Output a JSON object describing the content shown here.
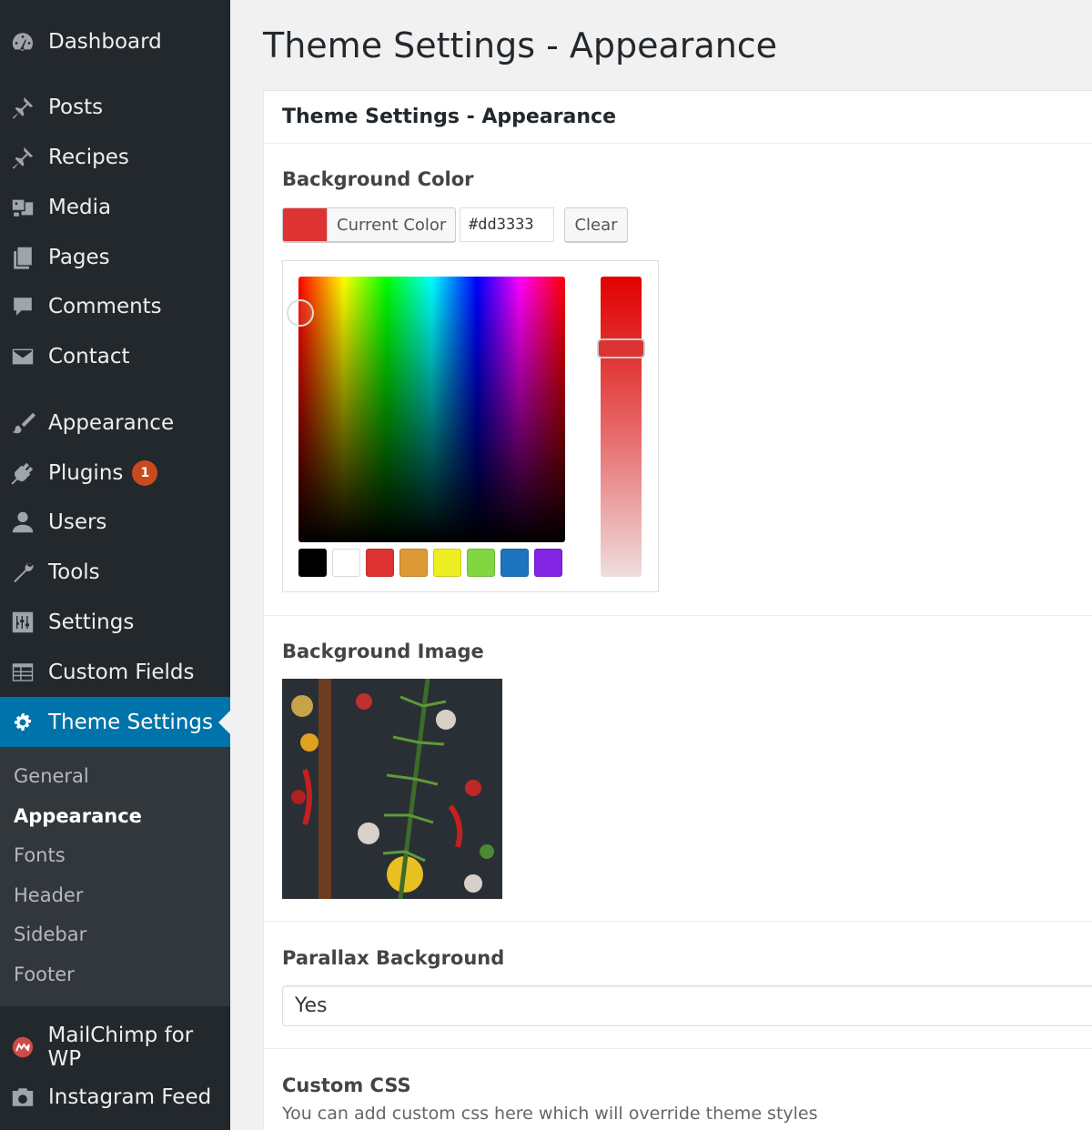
{
  "sidebar": {
    "items": [
      {
        "label": "Dashboard",
        "icon": "dashboard-icon"
      },
      {
        "label": "Posts",
        "icon": "pin-icon"
      },
      {
        "label": "Recipes",
        "icon": "pin-icon"
      },
      {
        "label": "Media",
        "icon": "media-icon"
      },
      {
        "label": "Pages",
        "icon": "pages-icon"
      },
      {
        "label": "Comments",
        "icon": "comment-icon"
      },
      {
        "label": "Contact",
        "icon": "envelope-icon"
      },
      {
        "label": "Appearance",
        "icon": "brush-icon"
      },
      {
        "label": "Plugins",
        "icon": "plug-icon",
        "badge": "1"
      },
      {
        "label": "Users",
        "icon": "user-icon"
      },
      {
        "label": "Tools",
        "icon": "wrench-icon"
      },
      {
        "label": "Settings",
        "icon": "sliders-icon"
      },
      {
        "label": "Custom Fields",
        "icon": "table-icon"
      },
      {
        "label": "Theme Settings",
        "icon": "gear-icon"
      },
      {
        "label": "MailChimp for WP",
        "icon": "mailchimp-icon"
      },
      {
        "label": "Instagram Feed",
        "icon": "camera-icon"
      }
    ],
    "submenu": [
      "General",
      "Appearance",
      "Fonts",
      "Header",
      "Sidebar",
      "Footer"
    ],
    "active_item": "Theme Settings",
    "active_sub": "Appearance"
  },
  "page": {
    "title": "Theme Settings - Appearance",
    "panel_title": "Theme Settings - Appearance"
  },
  "background_color": {
    "label": "Background Color",
    "button_label": "Current Color",
    "hex": "#dd3333",
    "clear_label": "Clear",
    "palette": [
      "#000000",
      "#ffffff",
      "#dd3333",
      "#dd9933",
      "#eeee22",
      "#81d742",
      "#1e73be",
      "#8224e3"
    ]
  },
  "background_image": {
    "label": "Background Image"
  },
  "parallax": {
    "label": "Parallax Background",
    "value": "Yes"
  },
  "custom_css": {
    "label": "Custom CSS",
    "description": "You can add custom css here which will override theme styles"
  },
  "colors": {
    "sidebar_bg": "#23282d",
    "submenu_bg": "#32373c",
    "active_bg": "#0073aa",
    "badge": "#ca4a1f"
  }
}
